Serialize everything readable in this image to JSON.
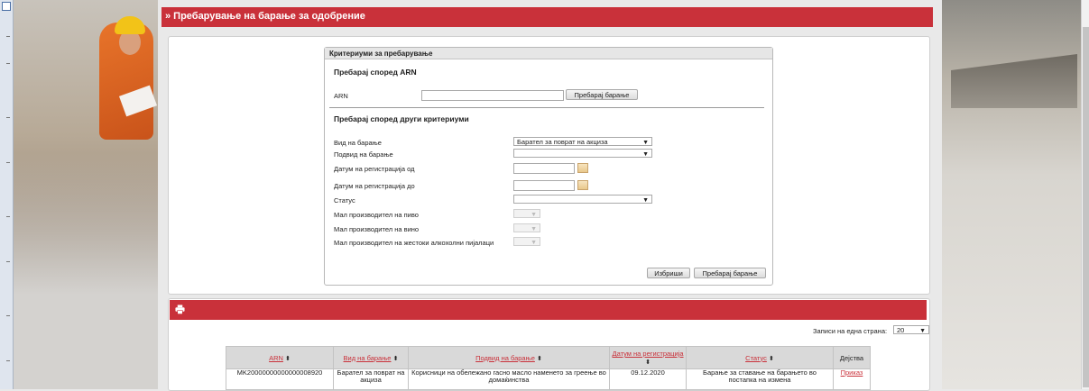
{
  "header": {
    "title": "» Пребарување на барање за одобрение"
  },
  "criteria": {
    "panel_title": "Критериуми за пребарување",
    "arn_section_title": "Пребарај според ARN",
    "arn_label": "ARN",
    "arn_value": "",
    "arn_search_button": "Пребарај барање",
    "other_section_title": "Пребарај според други критериуми",
    "fields": [
      {
        "label": "Вид на барање",
        "value": "Барател за поврат на акциза"
      },
      {
        "label": "Подвид на барање",
        "value": ""
      },
      {
        "label": "Датум на регистрација од",
        "value": ""
      },
      {
        "label": "Датум на регистрација до",
        "value": ""
      },
      {
        "label": "Статус",
        "value": ""
      },
      {
        "label": "Мал производител на пиво",
        "value": ""
      },
      {
        "label": "Мал производител на вино",
        "value": ""
      },
      {
        "label": "Мал производител на жестоки алкохолни пијалаци",
        "value": ""
      }
    ],
    "clear_button": "Избриши",
    "search_button": "Пребарај барање"
  },
  "results": {
    "per_page_label": "Записи на една страна:",
    "per_page_value": "20",
    "columns": [
      "ARN",
      "Вид на барање",
      "Подвид на барање",
      "Датум на регистрација",
      "Статус",
      "Дејства"
    ],
    "rows": [
      {
        "arn": "MK20000000000000008920",
        "type": "Барател за поврат на акциза",
        "subtype": "Корисници на обележано гасно масло наменето за греење во домаќинства",
        "date": "09.12.2020",
        "status": "Барање за ставање на барањето во постапка на измена",
        "action": "Приказ"
      }
    ]
  },
  "icons": {
    "print": "printer-icon",
    "calendar": "calendar-icon",
    "dropdown": "chevron-down-icon"
  },
  "colors": {
    "accent": "#c9313a"
  }
}
